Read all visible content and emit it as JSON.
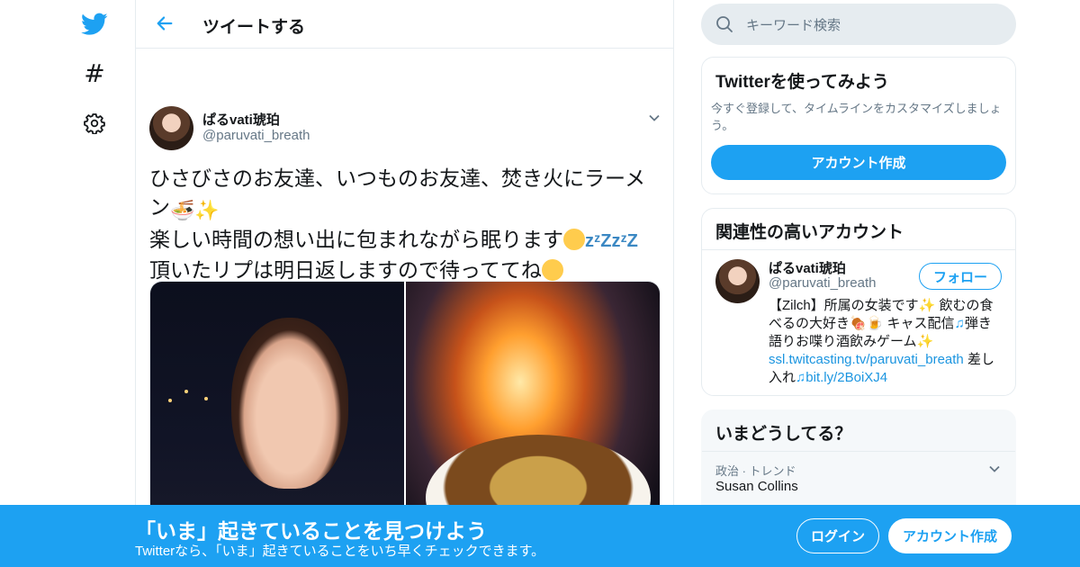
{
  "colors": {
    "brand": "#1da1f2",
    "text": "#14171a",
    "muted": "#657786",
    "border": "#e6ecf0"
  },
  "leftnav": {
    "icons": [
      "twitter-logo-icon",
      "hashtag-icon",
      "gear-icon"
    ]
  },
  "header": {
    "title": "ツイートする"
  },
  "tweet": {
    "author_name": "ぱるvati琥珀",
    "author_handle": "@paruvati_breath",
    "text_line1": "ひさびさのお友達、いつものお友達、焚き火にラーメ",
    "text_line2": "ン",
    "text_line3": "楽しい時間の想い出に包まれながら眠ります",
    "text_line4": "頂いたリプは明日返しますので待っててね",
    "zzz": "zᶻZ"
  },
  "search": {
    "placeholder": "キーワード検索"
  },
  "try_card": {
    "title": "Twitterを使ってみよう",
    "subtitle": "今すぐ登録して、タイムラインをカスタマイズしましょう。",
    "button": "アカウント作成"
  },
  "related_card": {
    "title": "関連性の高いアカウント",
    "name": "ぱるvati琥珀",
    "handle": "@paruvati_breath",
    "follow": "フォロー",
    "bio_1": "【Zilch】所属の女装です",
    "bio_2": " 飲むの食べるの大好き",
    "bio_3": " キャス配信",
    "bio_4": "弾き語りお喋り酒飲みゲーム",
    "bio_link1": "ssl.twitcasting.tv/paruvati_breath",
    "bio_5": " 差し入れ",
    "bio_link2": "bit.ly/2BoiXJ4"
  },
  "trends_card": {
    "title": "いまどうしてる？",
    "meta": "政治 · トレンド",
    "name": "Susan Collins"
  },
  "banner": {
    "title": "「いま」起きていることを見つけよう",
    "subtitle": "Twitterなら、「いま」起きていることをいち早くチェックできます。",
    "login": "ログイン",
    "signup": "アカウント作成"
  }
}
